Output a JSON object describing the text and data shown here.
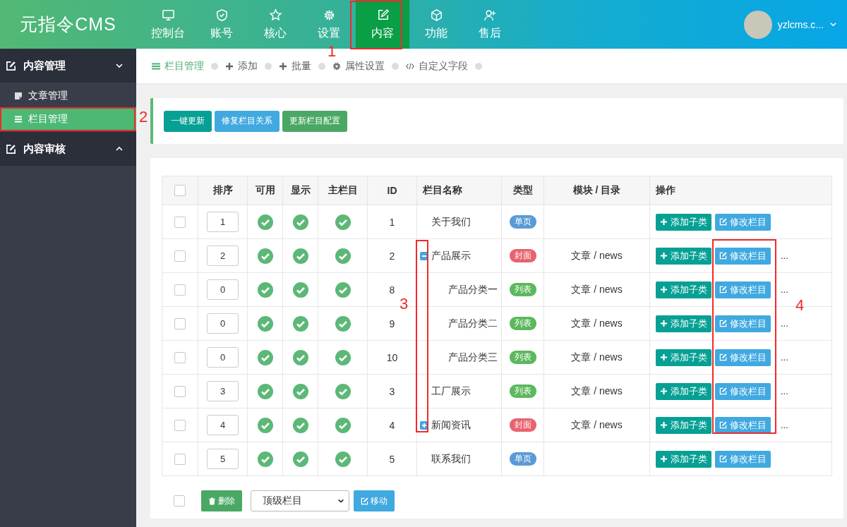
{
  "header": {
    "logo": "元指令CMS",
    "nav": [
      {
        "label": "控制台",
        "selected": false
      },
      {
        "label": "账号",
        "selected": false
      },
      {
        "label": "核心",
        "selected": false
      },
      {
        "label": "设置",
        "selected": false
      },
      {
        "label": "内容",
        "selected": true
      },
      {
        "label": "功能",
        "selected": false
      },
      {
        "label": "售后",
        "selected": false
      }
    ],
    "user": {
      "name": "yzlcms.c..."
    }
  },
  "sidebar": {
    "groups": [
      {
        "label": "内容管理",
        "expanded": true,
        "items": [
          {
            "label": "文章管理",
            "selected": false
          },
          {
            "label": "栏目管理",
            "selected": true
          }
        ]
      },
      {
        "label": "内容审核",
        "expanded": false
      }
    ]
  },
  "tabs": [
    {
      "label": "栏目管理",
      "selected": true
    },
    {
      "label": "添加",
      "selected": false
    },
    {
      "label": "批量",
      "selected": false
    },
    {
      "label": "属性设置",
      "selected": false
    },
    {
      "label": "自定义字段",
      "selected": false
    }
  ],
  "toolbar": {
    "buttons": [
      "一键更新",
      "修复栏目关系",
      "更新栏目配置"
    ]
  },
  "table": {
    "columns": [
      "排序",
      "可用",
      "显示",
      "主栏目",
      "ID",
      "栏目名称",
      "类型",
      "模块 / 目录",
      "操作"
    ],
    "header_checked": false,
    "rows": [
      {
        "checked": false,
        "sort": "1",
        "available": true,
        "visible": true,
        "main": true,
        "id": "1",
        "name": "关于我们",
        "type": "单页",
        "color": "#5b9bd5",
        "module": "",
        "actions": [
          "添加子类",
          "修改栏目"
        ]
      },
      {
        "checked": false,
        "sort": "2",
        "available": true,
        "visible": true,
        "main": true,
        "id": "2",
        "name": "产品展示",
        "expanded": true,
        "type": "封面",
        "color": "#e8636f",
        "module": "文章 / news",
        "actions": [
          "添加子类",
          "修改栏目"
        ],
        "more": "...",
        "children": [
          {
            "checked": false,
            "sort": "0",
            "available": true,
            "visible": true,
            "main": true,
            "id": "8",
            "name": "产品分类一",
            "type": "列表",
            "color": "#5cb85c",
            "module": "文章 / news",
            "actions": [
              "添加子类",
              "修改栏目"
            ],
            "more": "..."
          },
          {
            "checked": false,
            "sort": "0",
            "available": true,
            "visible": true,
            "main": true,
            "id": "9",
            "name": "产品分类二",
            "type": "列表",
            "color": "#5cb85c",
            "module": "文章 / news",
            "actions": [
              "添加子类",
              "修改栏目"
            ],
            "more": "..."
          },
          {
            "checked": false,
            "sort": "0",
            "available": true,
            "visible": true,
            "main": true,
            "id": "10",
            "name": "产品分类三",
            "type": "列表",
            "color": "#5cb85c",
            "module": "文章 / news",
            "actions": [
              "添加子类",
              "修改栏目"
            ],
            "more": "..."
          }
        ]
      },
      {
        "checked": false,
        "sort": "3",
        "available": true,
        "visible": true,
        "main": true,
        "id": "3",
        "name": "工厂展示",
        "type": "列表",
        "color": "#5cb85c",
        "module": "文章 / news",
        "actions": [
          "添加子类",
          "修改栏目"
        ],
        "more": "..."
      },
      {
        "checked": false,
        "sort": "4",
        "available": true,
        "visible": true,
        "main": true,
        "id": "4",
        "name": "新闻资讯",
        "expanded": false,
        "type": "封面",
        "color": "#e8636f",
        "module": "文章 / news",
        "actions": [
          "添加子类",
          "修改栏目"
        ],
        "more": "..."
      },
      {
        "checked": false,
        "sort": "5",
        "available": true,
        "visible": true,
        "main": true,
        "id": "5",
        "name": "联系我们",
        "type": "单页",
        "color": "#5b9bd5",
        "module": "",
        "actions": [
          "添加子类",
          "修改栏目"
        ]
      }
    ]
  },
  "bulk": {
    "checked": false,
    "delete": "删除",
    "target": "顶级栏目",
    "move": "移动"
  },
  "annotations": [
    {
      "label": "1"
    },
    {
      "label": "2"
    },
    {
      "label": "3"
    },
    {
      "label": "4"
    }
  ]
}
